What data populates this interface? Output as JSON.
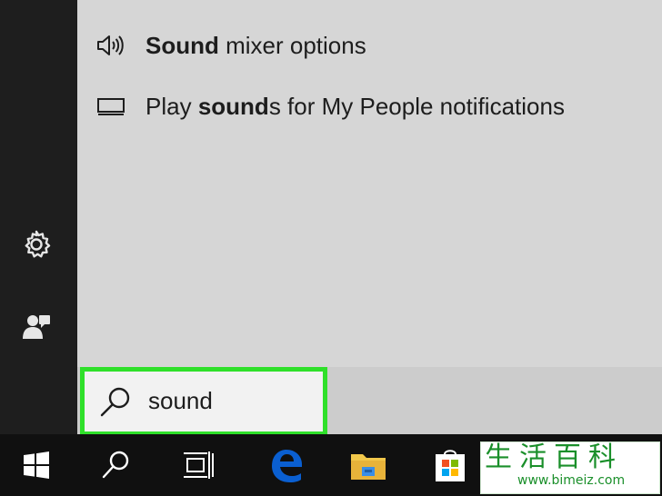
{
  "results": [
    {
      "icon": "speaker-icon",
      "bold": "Sound",
      "rest": " mixer options"
    },
    {
      "icon": "display-icon",
      "pre": "Play ",
      "bold": "sound",
      "post": "s for My People notifications"
    }
  ],
  "search": {
    "value": "sound"
  },
  "rail": {
    "items": [
      "settings-icon",
      "user-icon"
    ]
  },
  "taskbar": {
    "items": [
      "windows-start-icon",
      "search-icon",
      "task-view-icon",
      "edge-icon",
      "file-explorer-icon",
      "store-icon"
    ]
  },
  "watermark": {
    "chars": "生活百科",
    "url": "www.bimeiz.com"
  },
  "colors": {
    "highlight": "#2fe02a",
    "edge_blue": "#0a5fd1",
    "folder_yellow": "#f2c84b"
  }
}
